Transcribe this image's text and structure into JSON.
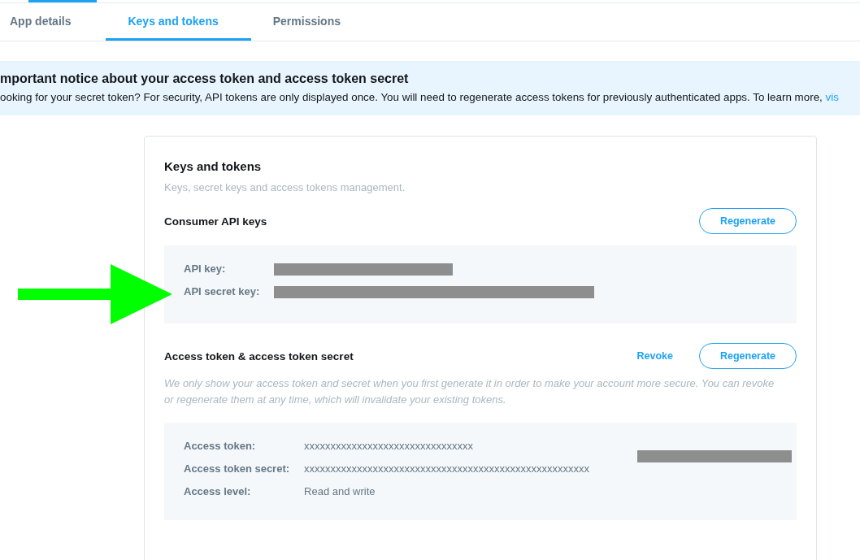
{
  "tabs": [
    {
      "label": "App details",
      "selected": false
    },
    {
      "label": "Keys and tokens",
      "selected": true
    },
    {
      "label": "Permissions",
      "selected": false
    }
  ],
  "notice": {
    "title": "mportant notice about your access token and access token secret",
    "text": "ooking for your secret token? For security, API tokens are only displayed once. You will need to regenerate access tokens for previously authenticated apps. To learn more, ",
    "link": "vis"
  },
  "card": {
    "title": "Keys and tokens",
    "subtitle": "Keys, secret keys and access tokens management.",
    "sections": [
      {
        "title": "Consumer API keys",
        "actions": [
          {
            "label": "Regenerate",
            "kind": "outline"
          }
        ],
        "fields": [
          {
            "label": "API key:",
            "kind": "redacted"
          },
          {
            "label": "API secret key:",
            "kind": "redacted"
          }
        ]
      },
      {
        "title": "Access token & access token secret",
        "description": "We only show your access token and secret when you first generate it in order to make your account more secure. You can revoke or regenerate them at any time, which will invalidate your existing tokens.",
        "actions": [
          {
            "label": "Revoke",
            "kind": "link"
          },
          {
            "label": "Regenerate",
            "kind": "outline"
          }
        ],
        "fields": [
          {
            "label": "Access token:",
            "kind": "text",
            "value": "xxxxxxxxxxxxxxxxxxxxxxxxxxxxxxxx"
          },
          {
            "label": "Access token secret:",
            "kind": "text",
            "value": "xxxxxxxxxxxxxxxxxxxxxxxxxxxxxxxxxxxxxxxxxxxxxxxxxxxxxx"
          },
          {
            "label": "Access level:",
            "kind": "text",
            "value": "Read and write"
          }
        ],
        "side": {
          "kind": "redacted"
        }
      }
    ]
  }
}
